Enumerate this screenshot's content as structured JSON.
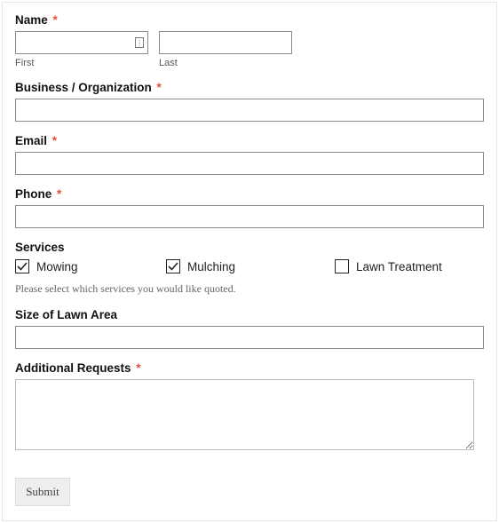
{
  "fields": {
    "name": {
      "label": "Name",
      "required": true,
      "first_sublabel": "First",
      "last_sublabel": "Last",
      "first_value": "",
      "last_value": ""
    },
    "business": {
      "label": "Business / Organization",
      "required": true,
      "value": ""
    },
    "email": {
      "label": "Email",
      "required": true,
      "value": ""
    },
    "phone": {
      "label": "Phone",
      "required": true,
      "value": ""
    },
    "services": {
      "label": "Services",
      "options": [
        {
          "label": "Mowing",
          "checked": true
        },
        {
          "label": "Mulching",
          "checked": true
        },
        {
          "label": "Lawn Treatment",
          "checked": false
        }
      ],
      "helper": "Please select which services you would like quoted."
    },
    "lawn_size": {
      "label": "Size of Lawn Area",
      "value": ""
    },
    "additional": {
      "label": "Additional Requests",
      "required": true,
      "value": ""
    }
  },
  "submit_label": "Submit",
  "required_marker": "*"
}
